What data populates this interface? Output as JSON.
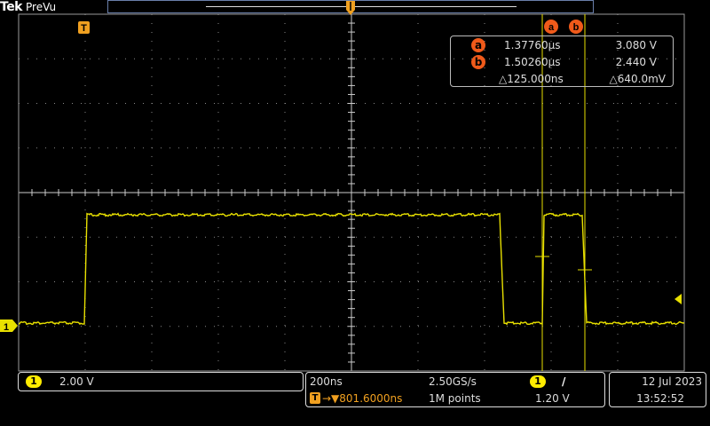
{
  "brand": {
    "name": "Tek",
    "mode": "PreVu"
  },
  "colors": {
    "trace": "#e8e000",
    "cursor": "#e8e000",
    "accent": "#f05a1a",
    "grid": "#9a9a9a"
  },
  "icons": {
    "trigger_position_marker": "T",
    "trigger_level_marker": "channel-1-ground-marker"
  },
  "trigger_marker": {
    "label": "T"
  },
  "channel_marker": {
    "label": "1"
  },
  "cursor_badges": {
    "a": "a",
    "b": "b"
  },
  "cursor_readout": {
    "a": {
      "badge": "a",
      "time": "1.37760µs",
      "voltage": "3.080 V"
    },
    "b": {
      "badge": "b",
      "time": "1.50260µs",
      "voltage": "2.440 V"
    },
    "delta": {
      "time": "△125.000ns",
      "voltage": "△640.0mV"
    }
  },
  "channel_status": {
    "channel": "1",
    "scale": "2.00 V"
  },
  "horizontal": {
    "scale": "200ns",
    "sample_rate": "2.50GS/s",
    "trigger_delay": "→▼801.6000ns",
    "record_length": "1M points",
    "trigger_delay_icon": "T"
  },
  "trigger_status": {
    "channel": "1",
    "slope_symbol": "/",
    "level": "1.20 V"
  },
  "clock": {
    "date": "12 Jul  2023",
    "time": "13:52:52"
  }
}
